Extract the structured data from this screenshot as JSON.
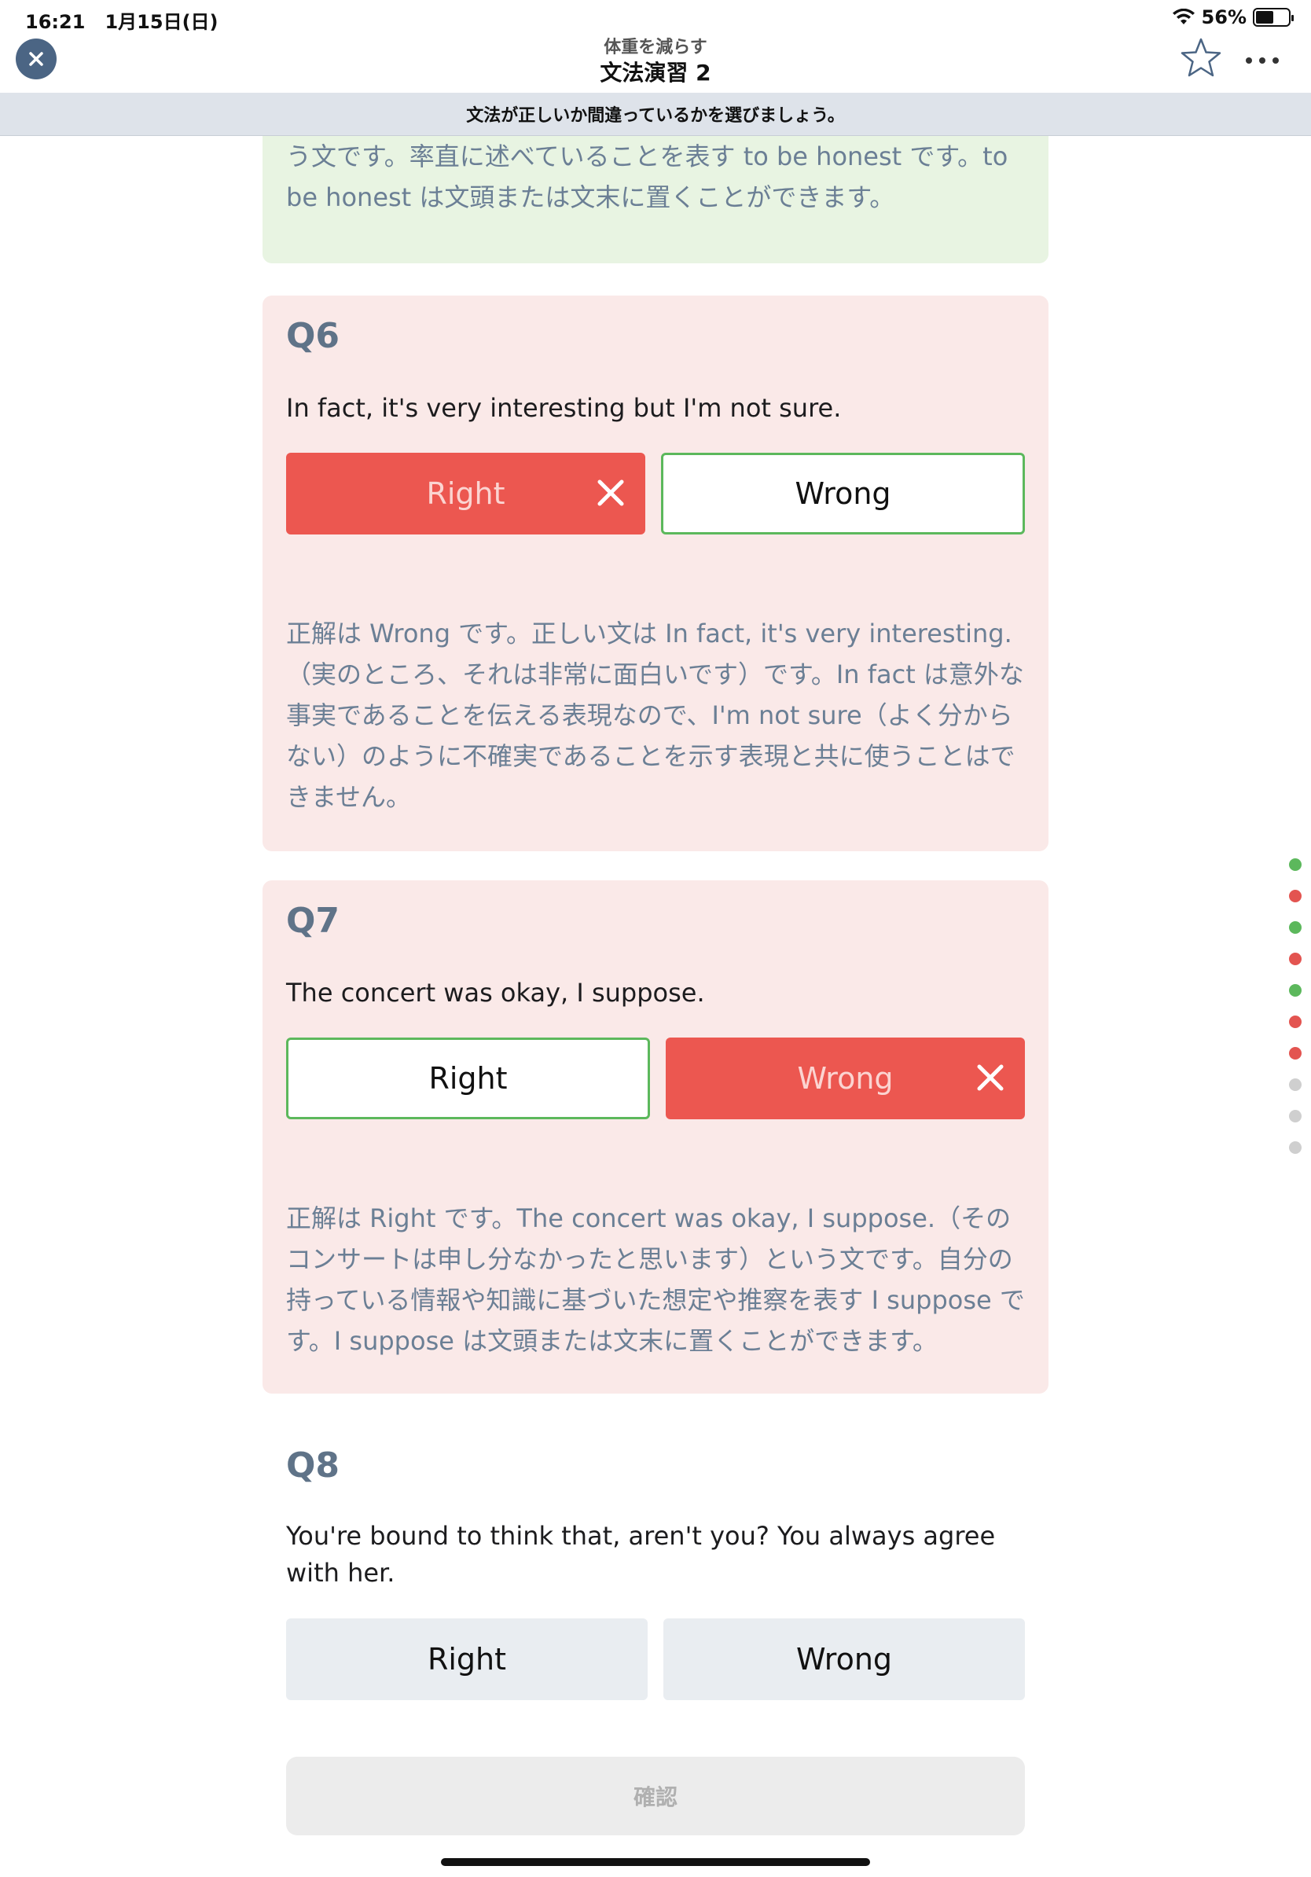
{
  "status_bar": {
    "time": "16:21",
    "date": "1月15日(日)",
    "battery_percent": "56%",
    "battery_level": 0.56
  },
  "nav": {
    "subtitle": "体重を減らす",
    "title": "文法演習 2"
  },
  "instruction": "文法が正しいか間違っているかを選びましょう。",
  "q5": {
    "explanation": "う文です。率直に述べていることを表す to be honest です。to be honest は文頭または文末に置くことができます。"
  },
  "q6": {
    "label": "Q6",
    "sentence": "In fact, it's very interesting but I'm not sure.",
    "right_label": "Right",
    "wrong_label": "Wrong",
    "selected": "Right",
    "correct": "Wrong",
    "explanation": "正解は Wrong です。正しい文は In fact, it's very interesting.（実のところ、それは非常に面白いです）です。In fact は意外な事実であることを伝える表現なので、I'm not sure（よく分からない）のように不確実であることを示す表現と共に使うことはできません。"
  },
  "q7": {
    "label": "Q7",
    "sentence": "The concert was okay, I suppose.",
    "right_label": "Right",
    "wrong_label": "Wrong",
    "selected": "Wrong",
    "correct": "Right",
    "explanation": "正解は Right です。The concert was okay, I suppose.（そのコンサートは申し分なかったと思います）という文です。自分の持っている情報や知識に基づいた想定や推察を表す I suppose です。I suppose は文頭または文末に置くことができます。"
  },
  "q8": {
    "label": "Q8",
    "sentence": "You're bound to think that, aren't you? You always agree with her.",
    "right_label": "Right",
    "wrong_label": "Wrong"
  },
  "confirm_label": "確認",
  "progress": [
    "correct",
    "incorrect",
    "correct",
    "incorrect",
    "correct",
    "incorrect",
    "incorrect",
    "unanswered",
    "unanswered",
    "unanswered"
  ],
  "colors": {
    "correct": "#5cb85c",
    "incorrect": "#e35450",
    "unanswered": "#cfcfcf",
    "accent": "#4b6584"
  }
}
